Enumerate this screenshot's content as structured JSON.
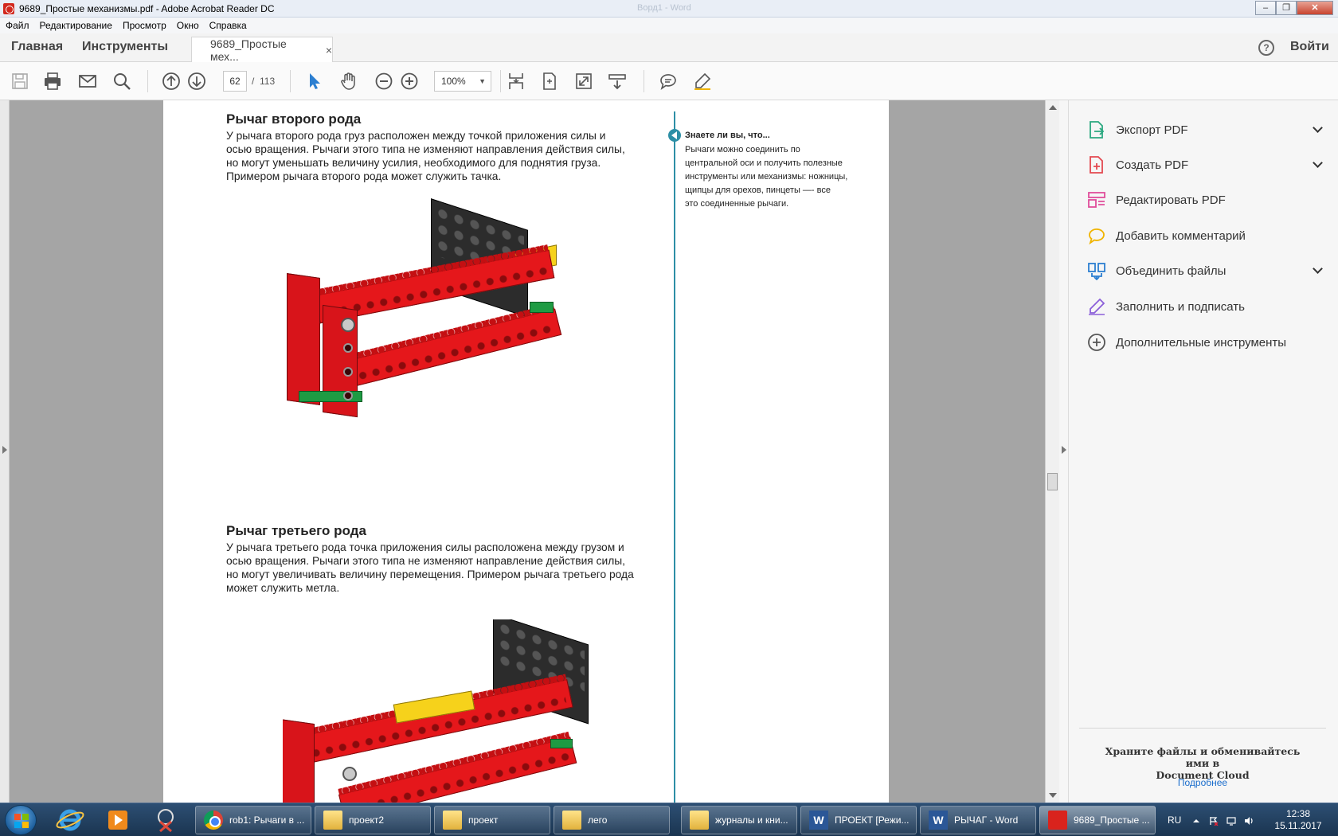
{
  "window": {
    "title": "9689_Простые механизмы.pdf - Adobe Acrobat Reader DC",
    "faded_title": "Ворд1 - Word"
  },
  "menu": [
    "Файл",
    "Редактирование",
    "Просмотр",
    "Окно",
    "Справка"
  ],
  "tabs": {
    "home": "Главная",
    "tools": "Инструменты",
    "document": "9689_Простые мех...",
    "close": "×",
    "help": "?",
    "signin": "Войти"
  },
  "toolbar": {
    "page_current": "62",
    "page_separator": "/",
    "page_total": "113",
    "zoom": "100%"
  },
  "document": {
    "section1_title": "Рычаг второго рода",
    "section1_lines": [
      "У рычага второго рода груз расположен между точкой приложения силы и",
      "осью вращения. Рычаги этого типа не изменяют направления действия силы,",
      "но могут уменьшать величину усилия, необходимого для поднятия груза.",
      "Примером рычага второго рода может служить тачка."
    ],
    "section2_title": "Рычаг третьего рода",
    "section2_lines": [
      "У рычага третьего рода точка приложения силы расположена между грузом и",
      "осью вращения. Рычаги этого типа не изменяют направление действия силы,",
      "но могут увеличивать величину перемещения. Примером рычага третьего рода",
      "может служить метла."
    ],
    "tip_title": "Знаете ли вы, что...",
    "tip_lines": [
      "Рычаги можно соединить по",
      "центральной оси и получить полезные",
      "инструменты или механизмы: ножницы,",
      "щипцы для орехов, пинцеты —- все",
      "это соединенные рычаги."
    ]
  },
  "right_pane": {
    "tools": [
      {
        "label": "Экспорт PDF",
        "icon": "export-pdf-icon",
        "color": "#2ba880",
        "expandable": true
      },
      {
        "label": "Создать PDF",
        "icon": "create-pdf-icon",
        "color": "#e34850",
        "expandable": true
      },
      {
        "label": "Редактировать PDF",
        "icon": "edit-pdf-icon",
        "color": "#e04d9b",
        "expandable": false
      },
      {
        "label": "Добавить комментарий",
        "icon": "comment-icon",
        "color": "#f0b400",
        "expandable": false
      },
      {
        "label": "Объединить файлы",
        "icon": "combine-files-icon",
        "color": "#2c7fd1",
        "expandable": true
      },
      {
        "label": "Заполнить и подписать",
        "icon": "fill-sign-icon",
        "color": "#8b5fd9",
        "expandable": false
      },
      {
        "label": "Дополнительные инструменты",
        "icon": "more-tools-icon",
        "color": "#555555",
        "expandable": false
      }
    ],
    "cloud_line1": "Храните файлы и обменивайтесь ими в",
    "cloud_line2": "Document Cloud",
    "cloud_link": "Подробнее"
  },
  "taskbar": {
    "tasks": [
      {
        "label": "rob1: Рычаги в ...",
        "icon": "chrome"
      },
      {
        "label": "проект2",
        "icon": "folder"
      },
      {
        "label": "проект",
        "icon": "folder"
      },
      {
        "label": "лего",
        "icon": "folder"
      },
      {
        "label": "журналы и кни...",
        "icon": "folder"
      },
      {
        "label": "ПРОЕКТ [Режи...",
        "icon": "word"
      },
      {
        "label": "РЫЧАГ - Word",
        "icon": "word"
      },
      {
        "label": "9689_Простые ...",
        "icon": "pdf"
      }
    ],
    "language": "RU",
    "time": "12:38",
    "date": "15.11.2017"
  },
  "colors": {
    "accent_line": "#2d8fa6",
    "link": "#1a6dcc",
    "lego_red": "#e5171b",
    "lego_black": "#2c2c2c",
    "lego_yellow": "#f6d21b",
    "lego_green": "#1e9b43"
  }
}
